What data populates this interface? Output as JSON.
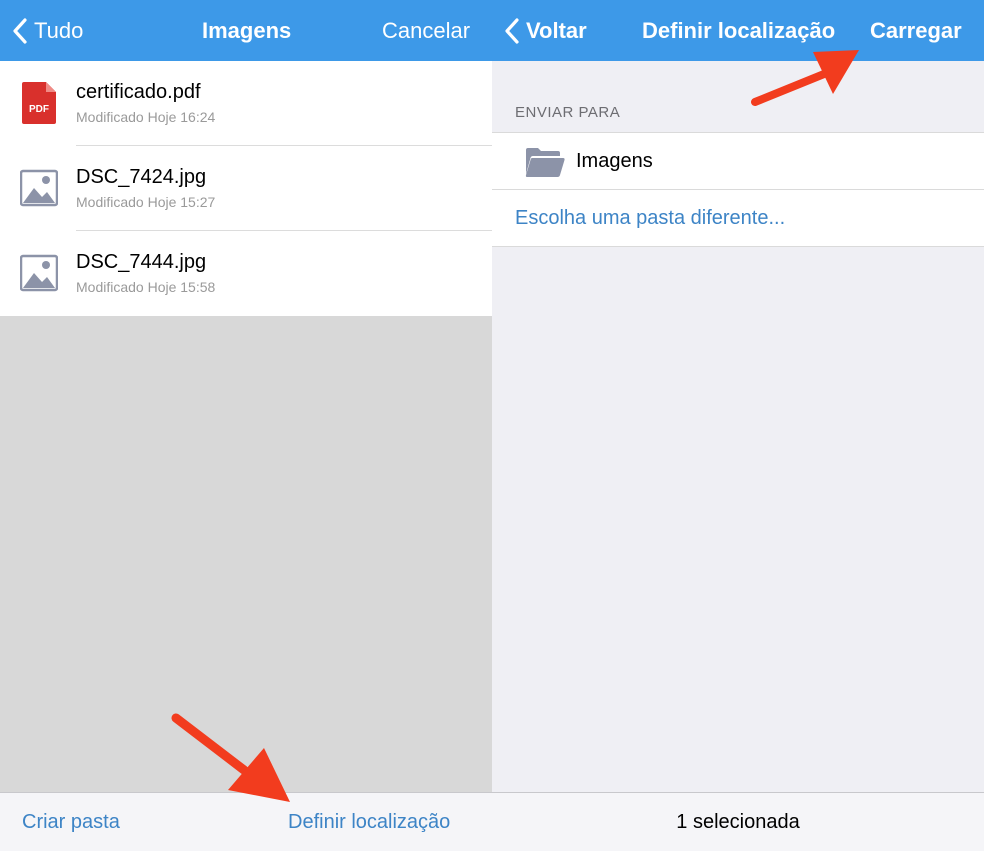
{
  "left": {
    "nav": {
      "back_label": "Tudo",
      "title": "Imagens",
      "cancel_label": "Cancelar"
    },
    "files": [
      {
        "name": "certificado.pdf",
        "meta": "Modificado Hoje 16:24",
        "icon": "pdf-file-icon",
        "icon_text": "PDF"
      },
      {
        "name": "DSC_7424.jpg",
        "meta": "Modificado Hoje 15:27",
        "icon": "image-file-icon"
      },
      {
        "name": "DSC_7444.jpg",
        "meta": "Modificado Hoje 15:58",
        "icon": "image-file-icon"
      }
    ],
    "toolbar": {
      "create_folder_label": "Criar pasta",
      "set_location_label": "Definir localização"
    }
  },
  "right": {
    "nav": {
      "back_label": "Voltar",
      "title": "Definir localização",
      "upload_label": "Carregar"
    },
    "section_header": "ENVIAR PARA",
    "destination_folder": "Imagens",
    "choose_other_label": "Escolha uma pasta diferente...",
    "status": "1 selecionada"
  },
  "colors": {
    "nav_bar": "#3d99e8",
    "link": "#3d84c6",
    "annotation_arrow": "#f23c1e",
    "pdf_icon": "#d9302c"
  }
}
